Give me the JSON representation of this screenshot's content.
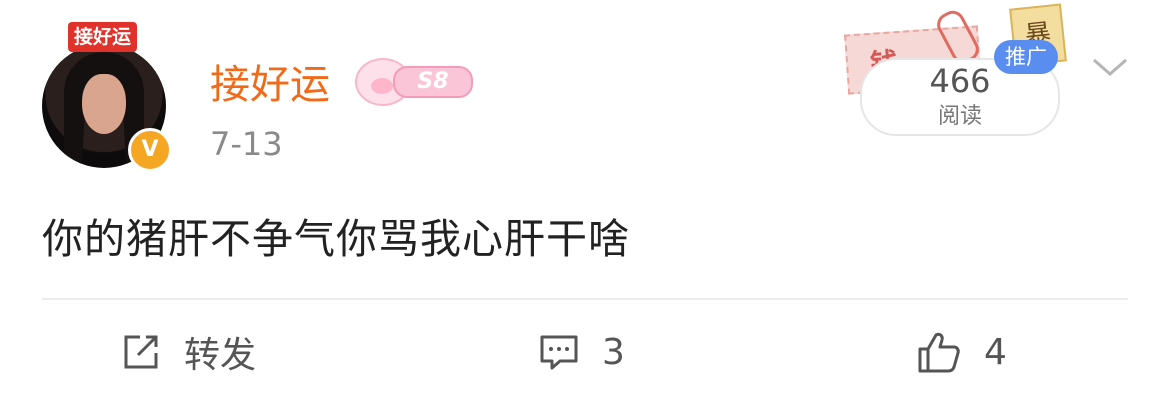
{
  "post": {
    "author": {
      "name": "接好运",
      "avatar_tag": "接好运",
      "verified_icon": "verified-v-icon",
      "level_badge": "S8",
      "name_color": "#f06a19"
    },
    "date": "7-13",
    "text": "你的猪肝不争气你骂我心肝干啥",
    "read_count": "466",
    "read_label": "阅读",
    "promo_label": "推广",
    "stamp_text": "钱",
    "stamp_tag_text": "暴"
  },
  "actions": {
    "repost": {
      "label": "转发",
      "icon": "share-icon"
    },
    "comment": {
      "count": "3",
      "icon": "comment-icon"
    },
    "like": {
      "count": "4",
      "icon": "thumb-up-icon"
    }
  },
  "colors": {
    "accent": "#f06a19",
    "verified": "#f5a623",
    "promo": "#5a8df0",
    "text": "#222222",
    "muted": "#8a8a8a"
  }
}
